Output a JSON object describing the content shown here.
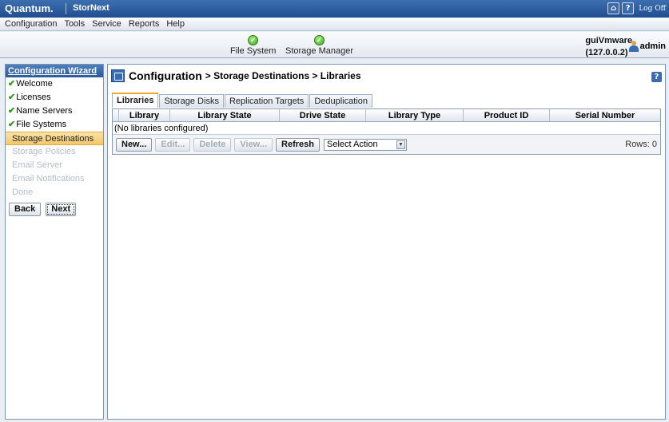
{
  "brand": {
    "logo": "Quantum.",
    "product": "StorNext"
  },
  "top_icons": {
    "home": "home-icon",
    "help": "help-icon",
    "logoff_label": "Log Off"
  },
  "menu": [
    "Configuration",
    "Tools",
    "Service",
    "Reports",
    "Help"
  ],
  "status": [
    {
      "label": "File System",
      "state": "ok"
    },
    {
      "label": "Storage Manager",
      "state": "ok"
    }
  ],
  "server": {
    "name": "guiVmware",
    "address": "(127.0.0.2)"
  },
  "user": {
    "name": "admin"
  },
  "wizard": {
    "title": "Configuration Wizard",
    "steps": [
      {
        "label": "Welcome",
        "status": "done"
      },
      {
        "label": "Licenses",
        "status": "done"
      },
      {
        "label": "Name Servers",
        "status": "done"
      },
      {
        "label": "File Systems",
        "status": "done"
      },
      {
        "label": "Storage Destinations",
        "status": "active"
      },
      {
        "label": "Storage Policies",
        "status": "disabled"
      },
      {
        "label": "Email Server",
        "status": "disabled"
      },
      {
        "label": "Email Notifications",
        "status": "disabled"
      },
      {
        "label": "Done",
        "status": "disabled"
      }
    ],
    "back_label": "Back",
    "next_label": "Next"
  },
  "page": {
    "title": "Configuration",
    "breadcrumb_rest": "> Storage Destinations > Libraries",
    "tabs": [
      "Libraries",
      "Storage Disks",
      "Replication Targets",
      "Deduplication"
    ],
    "active_tab": "Libraries",
    "columns": [
      "Library",
      "Library State",
      "Drive State",
      "Library Type",
      "Product ID",
      "Serial Number"
    ],
    "empty_message": "(No libraries configured)",
    "buttons": {
      "new": "New...",
      "edit": "Edit...",
      "delete": "Delete",
      "view": "View...",
      "refresh": "Refresh"
    },
    "action_select": "Select Action",
    "rows_label": "Rows: 0"
  },
  "colors": {
    "brand_bar": "#2b5a9a",
    "active_tab_accent": "#f0a92a",
    "active_step": "#f3c766",
    "ok_status": "#3fa81e"
  }
}
